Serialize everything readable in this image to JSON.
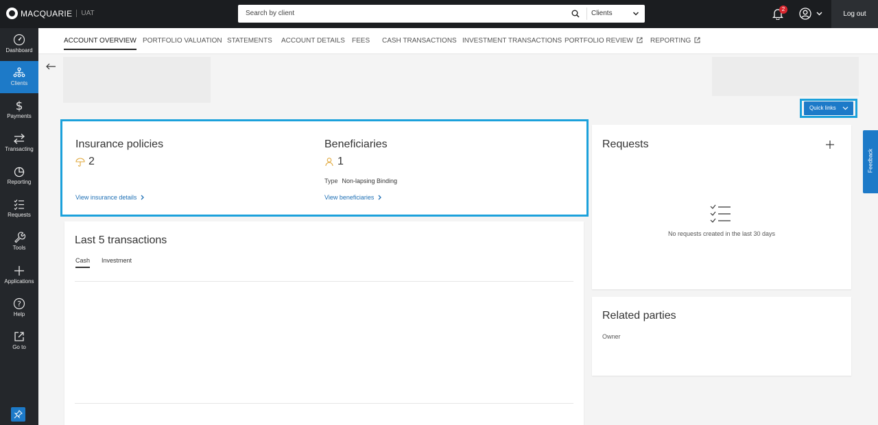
{
  "header": {
    "brand": "MACQUARIE",
    "environment": "UAT",
    "search_placeholder": "Search by client",
    "search_scope": "Clients",
    "notification_count": "2",
    "logout_label": "Log out"
  },
  "sidebar": {
    "items": [
      {
        "label": "Dashboard",
        "icon": "dashboard-icon"
      },
      {
        "label": "Clients",
        "icon": "clients-icon",
        "active": true
      },
      {
        "label": "Payments",
        "icon": "dollar-icon"
      },
      {
        "label": "Transacting",
        "icon": "transfer-arrows-icon"
      },
      {
        "label": "Reporting",
        "icon": "pie-chart-icon"
      },
      {
        "label": "Requests",
        "icon": "checklist-icon"
      },
      {
        "label": "Tools",
        "icon": "wrench-icon"
      },
      {
        "label": "Applications",
        "icon": "plus-icon"
      },
      {
        "label": "Help",
        "icon": "help-icon"
      },
      {
        "label": "Go to",
        "icon": "external-link-icon"
      }
    ]
  },
  "tabs": [
    {
      "label": "ACCOUNT OVERVIEW",
      "active": true
    },
    {
      "label": "PORTFOLIO VALUATION"
    },
    {
      "label": "STATEMENTS"
    },
    {
      "label": "ACCOUNT DETAILS"
    },
    {
      "label": "FEES"
    },
    {
      "label": "CASH TRANSACTIONS"
    },
    {
      "label": "INVESTMENT TRANSACTIONS"
    },
    {
      "label": "PORTFOLIO REVIEW",
      "external": true
    },
    {
      "label": "REPORTING",
      "external": true
    }
  ],
  "quick_links_label": "Quick links",
  "insurance": {
    "title": "Insurance policies",
    "count": "2",
    "link": "View insurance details"
  },
  "beneficiaries": {
    "title": "Beneficiaries",
    "count": "1",
    "type_label": "Type",
    "type_value": "Non-lapsing Binding",
    "link": "View beneficiaries"
  },
  "transactions": {
    "title": "Last 5 transactions",
    "tabs": [
      "Cash",
      "Investment"
    ]
  },
  "requests": {
    "title": "Requests",
    "empty_message": "No requests created in the last 30 days"
  },
  "related_parties": {
    "title": "Related parties",
    "role": "Owner"
  },
  "feedback_label": "Feedback",
  "colors": {
    "accent": "#1d7ac8",
    "highlight": "#1ba1db",
    "topbar": "#1b1d20",
    "sidebar": "#24272b",
    "insurance_icon": "#e0a73a"
  }
}
